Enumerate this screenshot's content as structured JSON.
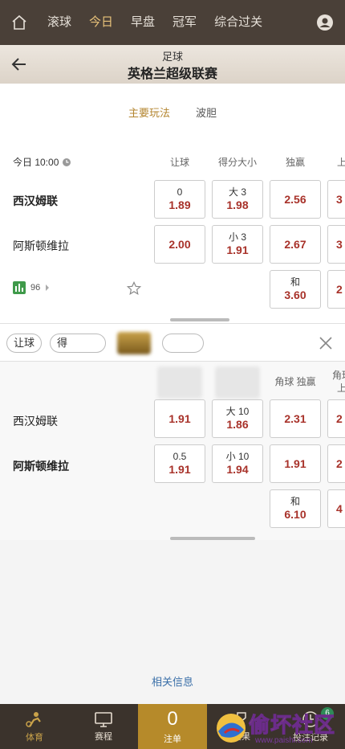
{
  "topnav": {
    "tabs": [
      {
        "label": "滚球",
        "active": false
      },
      {
        "label": "今日",
        "active": true
      },
      {
        "label": "早盘",
        "active": false
      },
      {
        "label": "冠军",
        "active": false
      },
      {
        "label": "综合过关",
        "active": false
      }
    ]
  },
  "header": {
    "category": "足球",
    "league": "英格兰超级联赛"
  },
  "subtabs": [
    {
      "label": "主要玩法",
      "active": true
    },
    {
      "label": "波胆",
      "active": false
    }
  ],
  "match": {
    "time": "今日 10:00",
    "home": "西汉姆联",
    "away": "阿斯顿维拉",
    "stats_count": "96"
  },
  "main_market": {
    "columns": [
      "让球",
      "得分大小",
      "独赢",
      "上"
    ],
    "home": {
      "handicap_line": "0",
      "handicap_odd": "1.89",
      "ou_line": "大 3",
      "ou_odd": "1.98",
      "win_odd": "2.56",
      "extra": "3"
    },
    "away": {
      "handicap_odd": "2.00",
      "ou_line": "小 3",
      "ou_odd": "1.91",
      "win_odd": "2.67",
      "extra": "3"
    },
    "draw": {
      "label": "和",
      "odd": "3.60",
      "extra": "2"
    }
  },
  "filter": {
    "chips": [
      "让球",
      "得"
    ]
  },
  "corner_market": {
    "columns": [
      "角球 独赢",
      "角球",
      "上"
    ],
    "home": {
      "team": "西汉姆联",
      "handicap_odd": "1.91",
      "ou_line": "大 10",
      "ou_odd": "1.86",
      "win_odd": "2.31",
      "extra": "2"
    },
    "away": {
      "team": "阿斯顿维拉",
      "handicap_line": "0.5",
      "handicap_odd": "1.91",
      "ou_line": "小 10",
      "ou_odd": "1.94",
      "win_odd": "1.91",
      "extra": "2"
    },
    "draw": {
      "label": "和",
      "odd": "6.10",
      "extra": "4"
    }
  },
  "related_info": "相关信息",
  "bottomnav": {
    "sports": "体育",
    "schedule": "赛程",
    "slip_count": "0",
    "slip": "注单",
    "results": "赛果",
    "records": "投注记录",
    "records_badge": "6"
  },
  "watermark": {
    "title": "偷坏社区",
    "url": "www.paishi.com"
  },
  "colors": {
    "nav_bg": "#4a4038",
    "accent": "#e8c27a",
    "odd_red": "#a8322a",
    "slip_gold": "#b68a2a"
  }
}
